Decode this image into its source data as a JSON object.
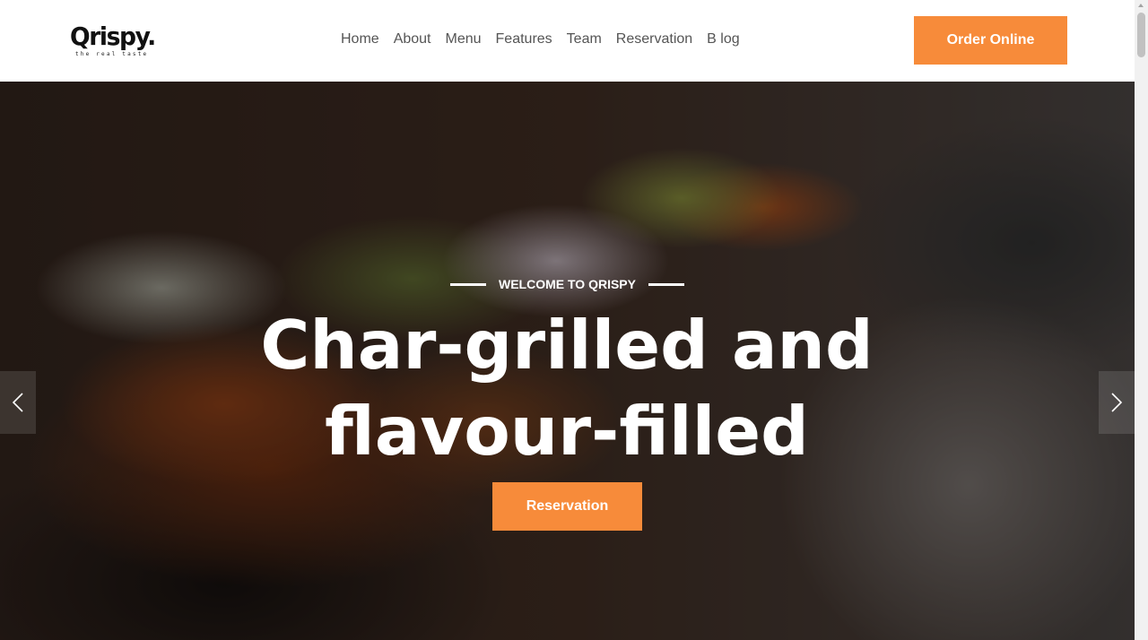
{
  "header": {
    "logo": {
      "wordmark": "Qrispy.",
      "tagline": "the real taste"
    },
    "nav": [
      {
        "label": "Home"
      },
      {
        "label": "About"
      },
      {
        "label": "Menu"
      },
      {
        "label": "Features"
      },
      {
        "label": "Team"
      },
      {
        "label": "Reservation"
      },
      {
        "label": "B log"
      }
    ],
    "order_button": "Order Online"
  },
  "hero": {
    "eyebrow": "WELCOME TO QRISPY",
    "title_line1": "Char-grilled and",
    "title_line2": "flavour-filled",
    "cta_button": "Reservation",
    "prev_icon": "chevron-left-icon",
    "next_icon": "chevron-right-icon"
  },
  "colors": {
    "accent": "#f78b3a",
    "nav_text": "#555555",
    "hero_text": "#ffffff"
  }
}
